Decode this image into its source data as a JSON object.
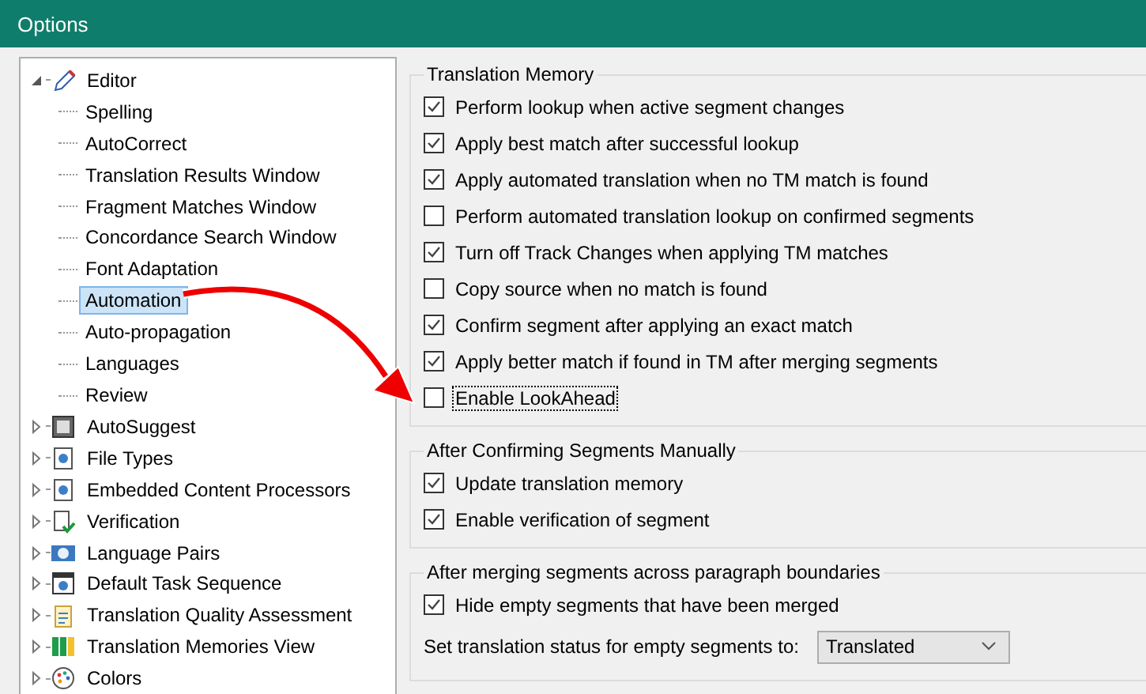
{
  "window": {
    "title": "Options"
  },
  "tree": [
    {
      "label": "Editor",
      "expanded": true,
      "selected": false,
      "children": [
        {
          "label": "Spelling",
          "selected": false
        },
        {
          "label": "AutoCorrect",
          "selected": false
        },
        {
          "label": "Translation Results Window",
          "selected": false
        },
        {
          "label": "Fragment Matches Window",
          "selected": false
        },
        {
          "label": "Concordance Search Window",
          "selected": false
        },
        {
          "label": "Font Adaptation",
          "selected": false
        },
        {
          "label": "Automation",
          "selected": true
        },
        {
          "label": "Auto-propagation",
          "selected": false
        },
        {
          "label": "Languages",
          "selected": false
        },
        {
          "label": "Review",
          "selected": false
        }
      ]
    },
    {
      "label": "AutoSuggest",
      "expanded": false,
      "selected": false
    },
    {
      "label": "File Types",
      "expanded": false,
      "selected": false
    },
    {
      "label": "Embedded Content Processors",
      "expanded": false,
      "selected": false
    },
    {
      "label": "Verification",
      "expanded": false,
      "selected": false
    },
    {
      "label": "Language Pairs",
      "expanded": false,
      "selected": false
    },
    {
      "label": "Default Task Sequence",
      "expanded": false,
      "selected": false
    },
    {
      "label": "Translation Quality Assessment",
      "expanded": false,
      "selected": false
    },
    {
      "label": "Translation Memories View",
      "expanded": false,
      "selected": false
    },
    {
      "label": "Colors",
      "expanded": false,
      "selected": false
    }
  ],
  "groups": [
    {
      "title": "Translation Memory",
      "options": [
        {
          "label": "Perform lookup when active segment changes",
          "checked": true,
          "focused": false
        },
        {
          "label": "Apply best match after successful lookup",
          "checked": true,
          "focused": false
        },
        {
          "label": "Apply automated translation when no TM match is found",
          "checked": true,
          "focused": false
        },
        {
          "label": "Perform automated translation lookup on confirmed segments",
          "checked": false,
          "focused": false
        },
        {
          "label": "Turn off Track Changes when applying TM matches",
          "checked": true,
          "focused": false
        },
        {
          "label": "Copy source when no match is found",
          "checked": false,
          "focused": false
        },
        {
          "label": "Confirm segment after applying an exact match",
          "checked": true,
          "focused": false
        },
        {
          "label": "Apply better match if found in TM after merging segments",
          "checked": true,
          "focused": false
        },
        {
          "label": "Enable LookAhead",
          "checked": false,
          "focused": true
        }
      ]
    },
    {
      "title": "After Confirming Segments Manually",
      "options": [
        {
          "label": "Update translation memory",
          "checked": true,
          "focused": false
        },
        {
          "label": "Enable verification of segment",
          "checked": true,
          "focused": false
        }
      ]
    },
    {
      "title": "After merging segments across paragraph boundaries",
      "options": [
        {
          "label": "Hide empty segments that have been merged",
          "checked": true,
          "focused": false
        }
      ],
      "select": {
        "label": "Set translation status for empty segments to:",
        "value": "Translated"
      }
    }
  ]
}
